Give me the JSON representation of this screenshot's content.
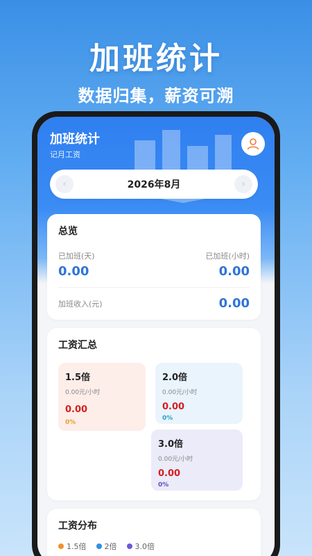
{
  "promo": {
    "headline": "加班统计",
    "subline": "数据归集，薪资可溯"
  },
  "app": {
    "title": "加班统计",
    "subtitle": "记月工资",
    "avatar_icon": "user-icon",
    "date": "2026年8月",
    "prev_icon": "chevron-left-icon",
    "next_icon": "chevron-right-icon"
  },
  "overview": {
    "title": "总览",
    "days_label": "已加班(天)",
    "days_value": "0.00",
    "hours_label": "已加班(小时)",
    "hours_value": "0.00",
    "income_label": "加班收入(元)",
    "income_value": "0.00"
  },
  "summary": {
    "title": "工资汇总",
    "tiles": [
      {
        "name": "1.5倍",
        "rate": "0.00元/小时",
        "amount": "0.00",
        "pct": "0%",
        "pct_color": "#e8a02a"
      },
      {
        "name": "2.0倍",
        "rate": "0.00元/小时",
        "amount": "0.00",
        "pct": "0%",
        "pct_color": "#2aa3c6"
      },
      {
        "name": "3.0倍",
        "rate": "0.00元/小时",
        "amount": "0.00",
        "pct": "0%",
        "pct_color": "#5b4fc8"
      }
    ]
  },
  "distribution": {
    "title": "工资分布",
    "legend": [
      {
        "label": "1.5倍",
        "color": "#f0922b"
      },
      {
        "label": "2倍",
        "color": "#2f8fe8"
      },
      {
        "label": "3.0倍",
        "color": "#6a5ad8"
      }
    ]
  },
  "colors": {
    "accent": "#2f74d8",
    "amount_red": "#d32020"
  }
}
